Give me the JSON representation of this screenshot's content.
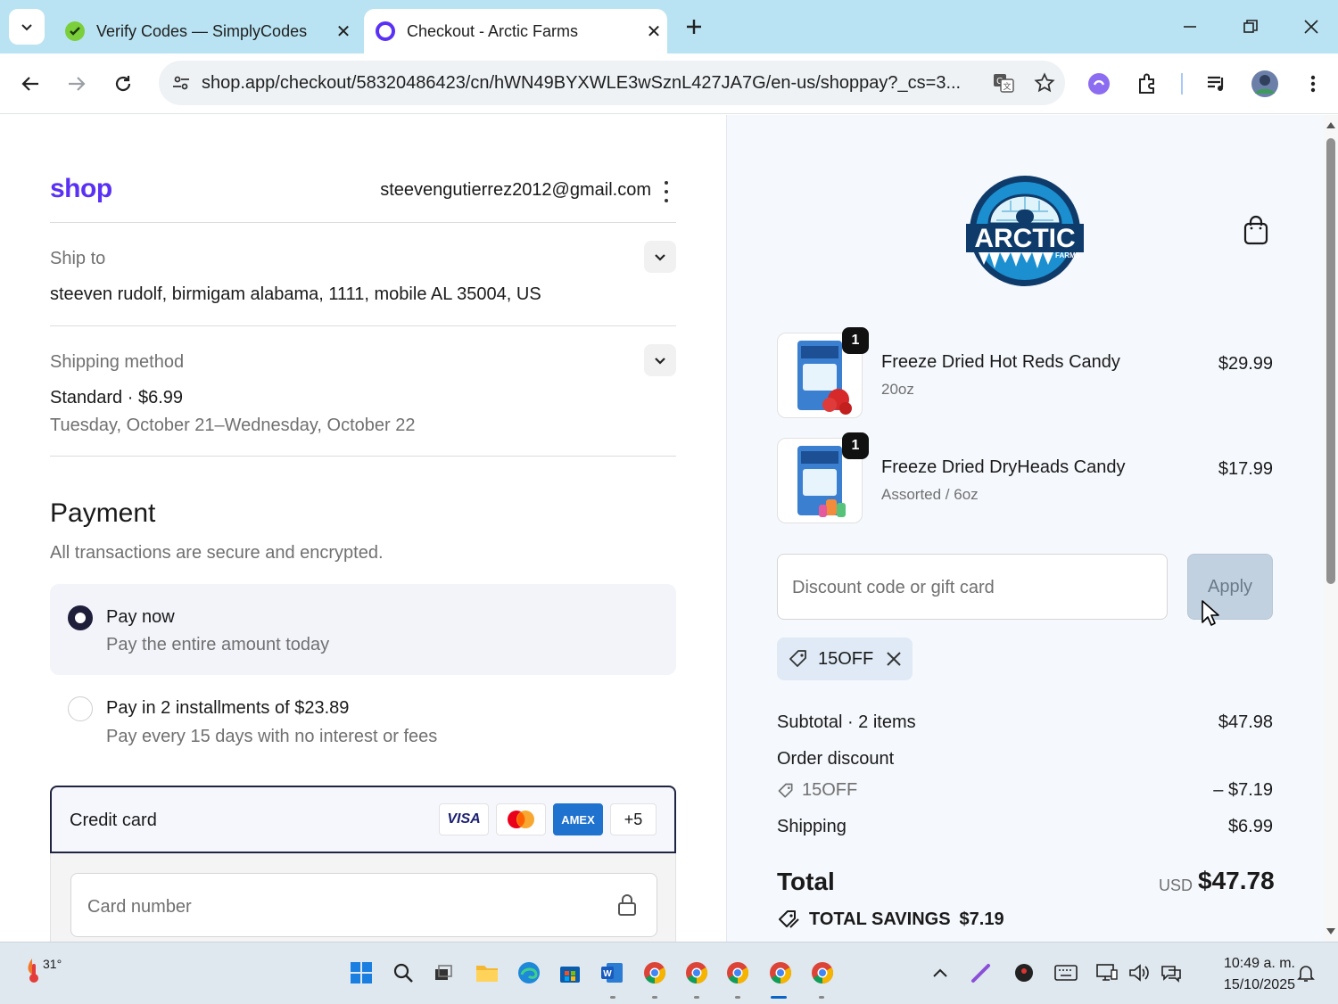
{
  "browser": {
    "tabs": [
      {
        "title": "Verify Codes — SimplyCodes",
        "active": false
      },
      {
        "title": "Checkout - Arctic Farms",
        "active": true
      }
    ],
    "url": "shop.app/checkout/58320486423/cn/hWN49BYXWLE3wSznL427JA7G/en-us/shoppay?_cs=3..."
  },
  "header": {
    "logo": "shop",
    "email": "steevengutierrez2012@gmail.com"
  },
  "ship_to": {
    "label": "Ship to",
    "address": "steeven rudolf, birmigam alabama, 1111, mobile AL 35004, US"
  },
  "shipping_method": {
    "label": "Shipping method",
    "method": "Standard · $6.99",
    "dates": "Tuesday, October 21–Wednesday, October 22"
  },
  "payment": {
    "title": "Payment",
    "subtitle": "All transactions are secure and encrypted.",
    "options": [
      {
        "title": "Pay now",
        "sub": "Pay the entire amount today",
        "selected": true
      },
      {
        "title": "Pay in 2 installments of $23.89",
        "sub": "Pay every 15 days with no interest or fees",
        "selected": false
      }
    ],
    "credit_card_label": "Credit card",
    "brands": [
      "VISA",
      "Mastercard",
      "AMEX",
      "+5"
    ],
    "card_number_placeholder": "Card number"
  },
  "store": {
    "logo_main": "ARCTIC",
    "logo_sub": "FARMS"
  },
  "items": [
    {
      "qty": "1",
      "name": "Freeze Dried Hot Reds Candy",
      "variant": "20oz",
      "price": "$29.99"
    },
    {
      "qty": "1",
      "name": "Freeze Dried DryHeads Candy",
      "variant": "Assorted / 6oz",
      "price": "$17.99"
    }
  ],
  "discount": {
    "placeholder": "Discount code or gift card",
    "apply_label": "Apply",
    "applied_code": "15OFF"
  },
  "summary": {
    "subtotal_label": "Subtotal · 2 items",
    "subtotal_value": "$47.98",
    "order_discount_label": "Order discount",
    "discount_code": "15OFF",
    "discount_value": "– $7.19",
    "shipping_label": "Shipping",
    "shipping_value": "$6.99",
    "total_label": "Total",
    "currency": "USD",
    "total_value": "$47.78",
    "savings_label": "TOTAL SAVINGS",
    "savings_value": "$7.19"
  },
  "taskbar": {
    "temperature": "31°",
    "time": "10:49 a. m.",
    "date": "15/10/2025"
  },
  "colors": {
    "shop_brand": "#5a31f4",
    "tabbar": "#b9e3f2",
    "selected_option_bg": "#f2f4fa",
    "summary_bg": "#f5f8fc",
    "apply_disabled": "#c2d1e0"
  }
}
